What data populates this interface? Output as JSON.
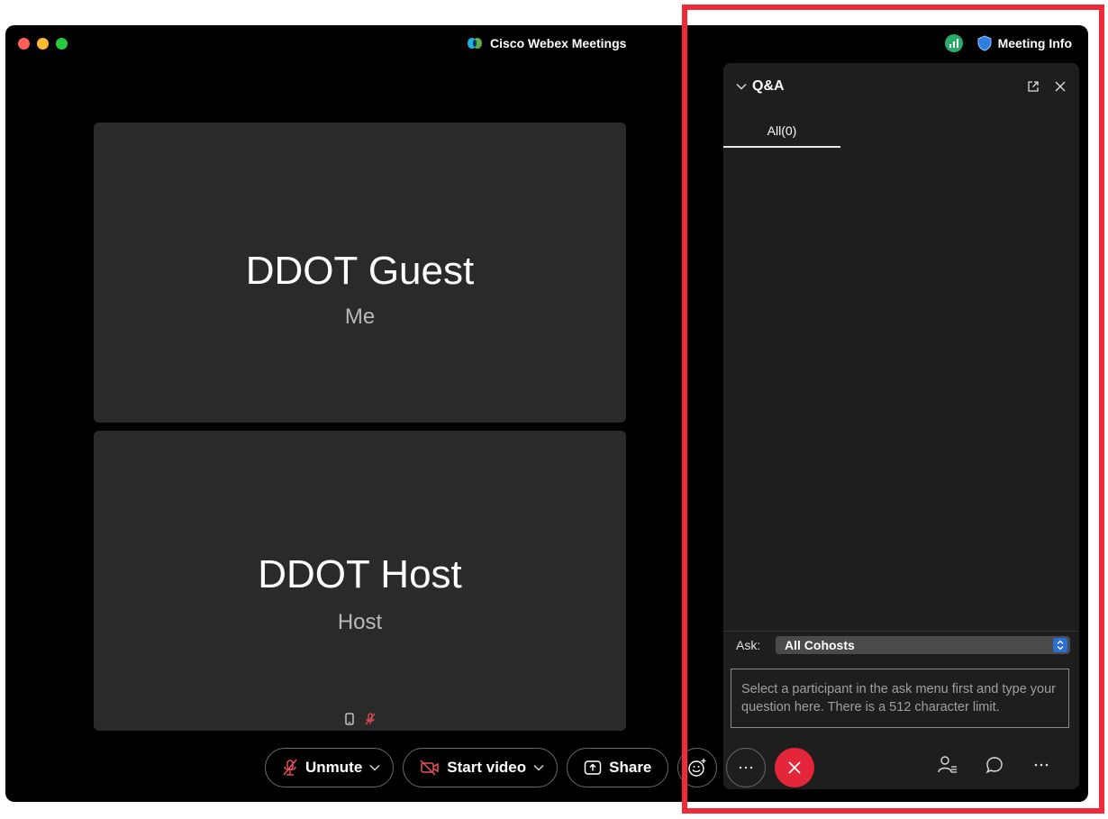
{
  "window": {
    "app_title": "Cisco Webex Meetings",
    "meeting_info_label": "Meeting Info"
  },
  "tiles": [
    {
      "name": "DDOT Guest",
      "subtitle": "Me"
    },
    {
      "name": "DDOT Host",
      "subtitle": "Host"
    }
  ],
  "qa_panel": {
    "title": "Q&A",
    "tab_all": "All(0)",
    "ask_label": "Ask:",
    "ask_selected": "All Cohosts",
    "question_placeholder": "Select a participant in the ask menu first and type your question here. There is a 512 character limit."
  },
  "controls": {
    "unmute_label": "Unmute",
    "start_video_label": "Start video",
    "share_label": "Share"
  },
  "colors": {
    "end_call": "#e3263a",
    "signal": "#2bab6a",
    "highlight": "#ee2a3b",
    "muted_icon": "#e8505b"
  }
}
